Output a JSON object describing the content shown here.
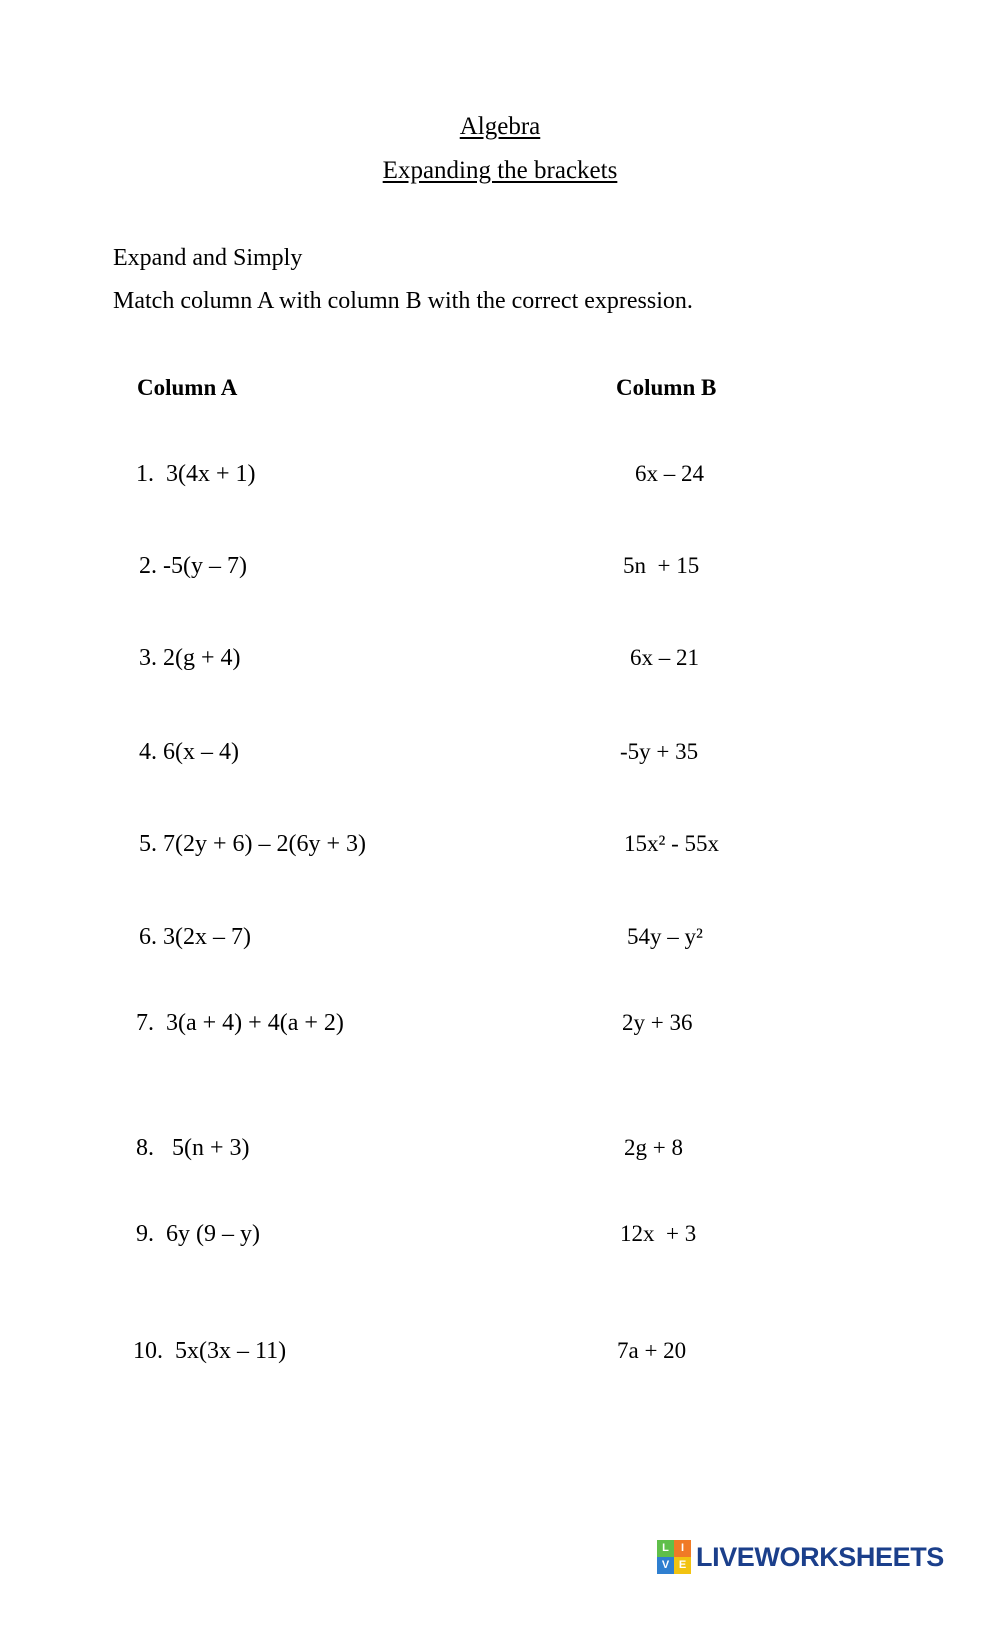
{
  "document": {
    "title_main": "Algebra",
    "title_sub": "Expanding the brackets",
    "instruction_1": "Expand and Simply",
    "instruction_2": "Match column A with column B with the correct expression."
  },
  "headers": {
    "column_a": "Column A",
    "column_b": "Column B"
  },
  "rows": [
    {
      "a": "1.  3(4x + 1)",
      "b": "6x – 24"
    },
    {
      "a": "2. -5(y – 7)",
      "b": "5n  + 15"
    },
    {
      "a": "3. 2(g + 4)",
      "b": "6x – 21"
    },
    {
      "a": "4. 6(x – 4)",
      "b": "-5y + 35"
    },
    {
      "a": "5. 7(2y + 6) – 2(6y + 3)",
      "b": "15x² - 55x"
    },
    {
      "a": "6. 3(2x – 7)",
      "b": "54y – y²"
    },
    {
      "a": "7.  3(a + 4) + 4(a + 2)",
      "b": "2y + 36"
    },
    {
      "a": "8.   5(n + 3)",
      "b": "2g + 8"
    },
    {
      "a": "9.  6y (9 – y)",
      "b": "12x  + 3"
    },
    {
      "a": "10.  5x(3x – 11)",
      "b": "7a + 20"
    }
  ],
  "footer": {
    "logo_tiles": [
      "L",
      "I",
      "V",
      "E"
    ],
    "logo_word": "LIVEWORKSHEETS",
    "colors": {
      "tile_l": "#5fbf4a",
      "tile_i": "#f07a26",
      "tile_v": "#2f7fd0",
      "tile_e": "#f2c311",
      "word": "#1b3f8b"
    }
  }
}
